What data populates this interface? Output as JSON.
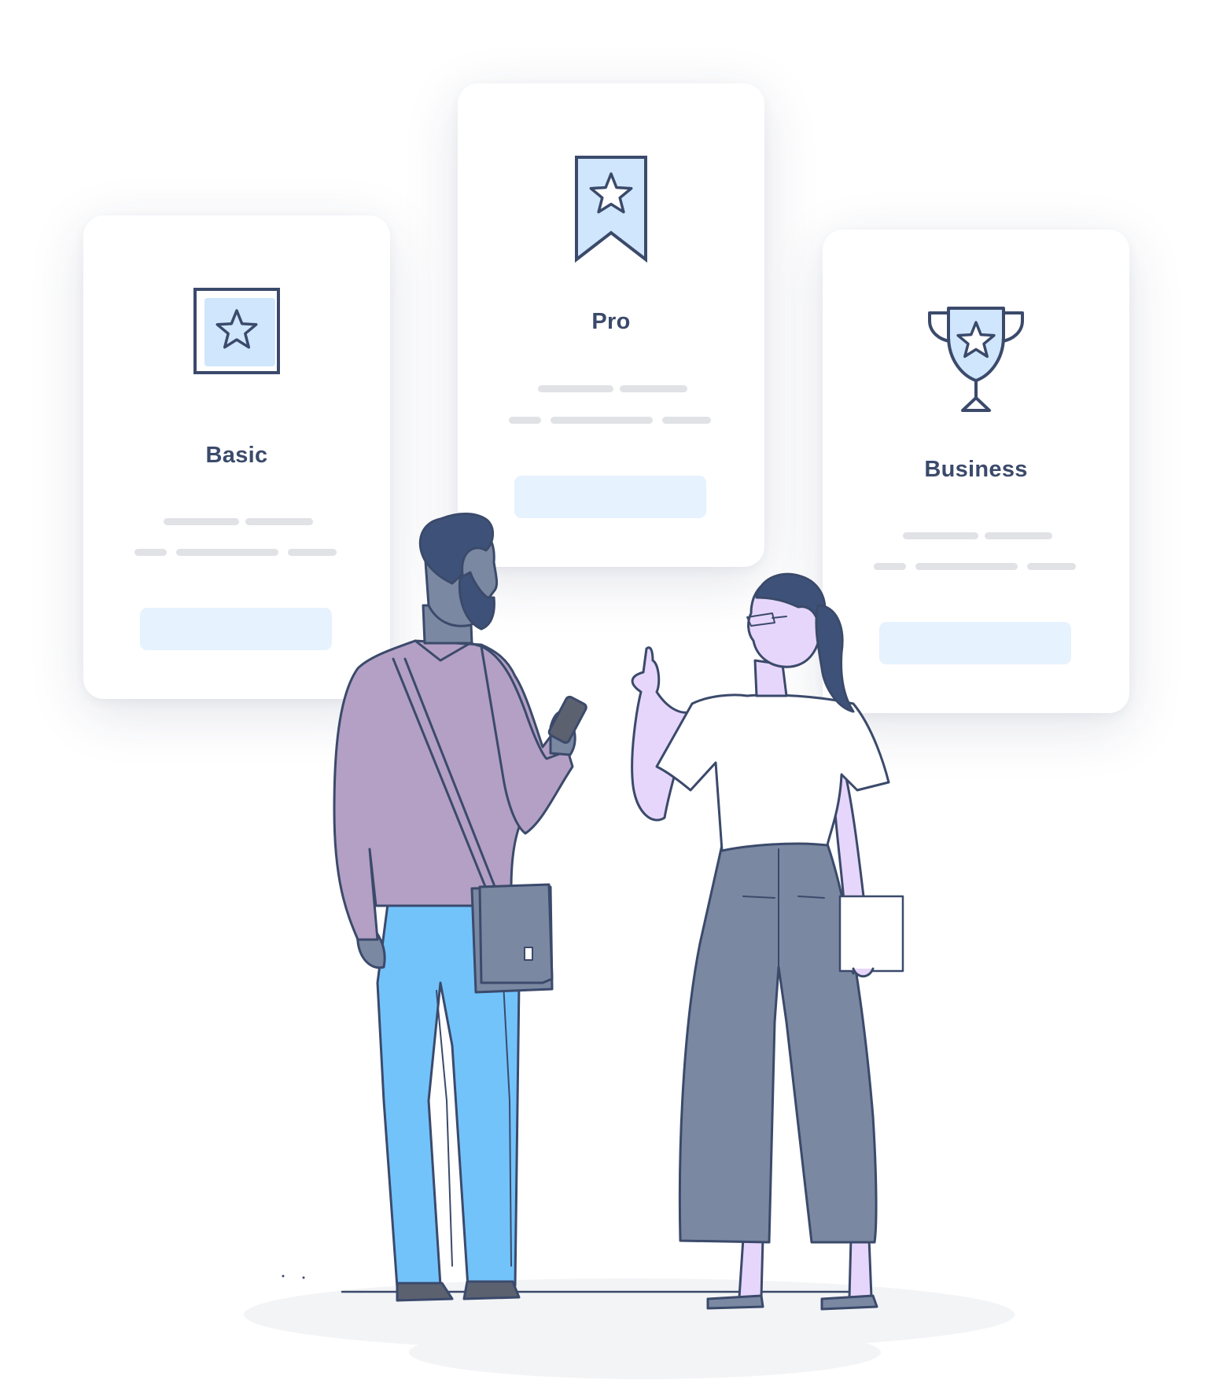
{
  "plans": [
    {
      "id": "basic",
      "title": "Basic",
      "icon": "framed-star-icon"
    },
    {
      "id": "pro",
      "title": "Pro",
      "icon": "bookmark-star-icon"
    },
    {
      "id": "business",
      "title": "Business",
      "icon": "trophy-star-icon"
    }
  ],
  "colors": {
    "card_background": "#ffffff",
    "title_text": "#3b4a6b",
    "placeholder_bar": "#e1e2e6",
    "button_fill": "#e6f2fe",
    "icon_fill": "#cfe6fd",
    "icon_stroke": "#3b4a6b",
    "jacket": "#b3a0c4",
    "jeans": "#73c3fb",
    "trousers": "#7b88a2",
    "skin_purple": "#e7d6fb",
    "hair": "#3e5279",
    "floor_shadow": "#f3f4f6"
  },
  "illustration": {
    "people": [
      "man-with-phone-and-bag",
      "woman-pointing-with-paper"
    ]
  }
}
